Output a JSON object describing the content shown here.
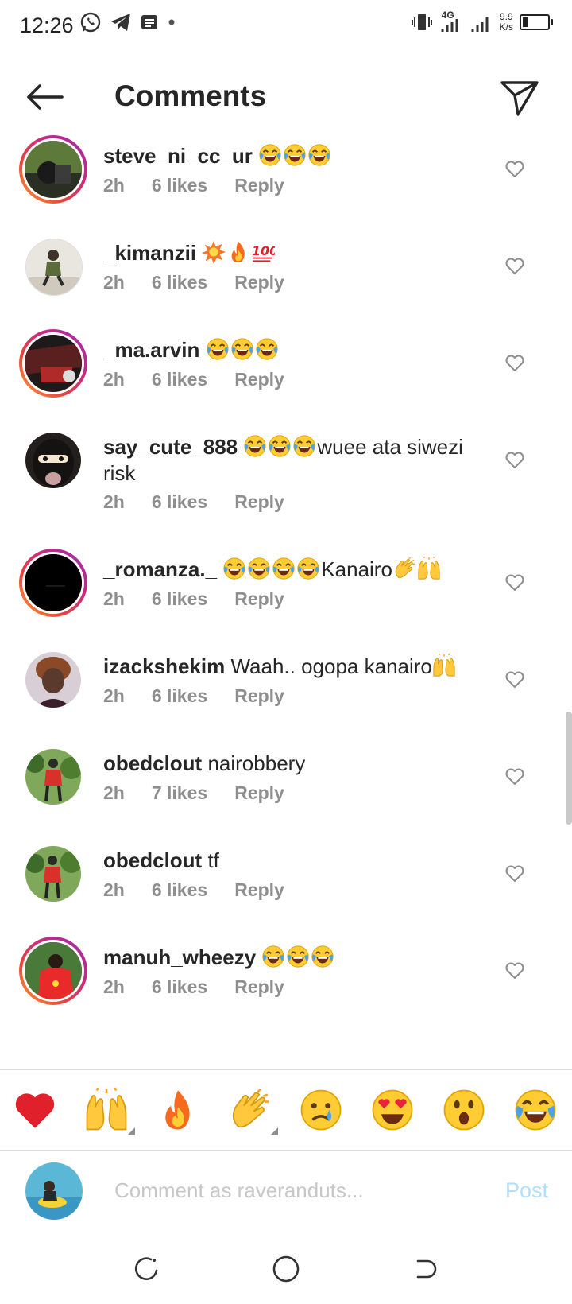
{
  "status_bar": {
    "time": "12:26",
    "network": "4G",
    "speed_top": "9.9",
    "speed_bottom": "K/s"
  },
  "header": {
    "title": "Comments"
  },
  "comments": [
    {
      "username": "steve_ni_cc_ur",
      "text": "",
      "time": "2h",
      "likes": "6 likes",
      "reply": "Reply",
      "ring": true
    },
    {
      "username": "_kimanzii",
      "text": "",
      "time": "2h",
      "likes": "6 likes",
      "reply": "Reply",
      "ring": false
    },
    {
      "username": "_ma.arvin",
      "text": "",
      "time": "2h",
      "likes": "6 likes",
      "reply": "Reply",
      "ring": true
    },
    {
      "username": "say_cute_888",
      "text": "wuee ata siwezi risk",
      "time": "2h",
      "likes": "6 likes",
      "reply": "Reply",
      "ring": false
    },
    {
      "username": "_romanza._",
      "text": "Kanairo",
      "time": "2h",
      "likes": "6 likes",
      "reply": "Reply",
      "ring": true
    },
    {
      "username": "izackshekim",
      "text": "Waah.. ogopa kanairo",
      "time": "2h",
      "likes": "6 likes",
      "reply": "Reply",
      "ring": false
    },
    {
      "username": "obedclout",
      "text": "nairobbery",
      "time": "2h",
      "likes": "7 likes",
      "reply": "Reply",
      "ring": false
    },
    {
      "username": "obedclout",
      "text": "tf",
      "time": "2h",
      "likes": "6 likes",
      "reply": "Reply",
      "ring": false
    },
    {
      "username": "manuh_wheezy",
      "text": "",
      "time": "2h",
      "likes": "6 likes",
      "reply": "Reply",
      "ring": true
    }
  ],
  "emoji_bar": [
    "red-heart",
    "raising-hands",
    "fire",
    "clapping-hands",
    "crying-face",
    "heart-eyes",
    "astonished-face",
    "tears-of-joy"
  ],
  "composer": {
    "placeholder": "Comment as raveranduts...",
    "post_label": "Post"
  },
  "colors": {
    "post_disabled": "#b2dffc",
    "meta_gray": "#8e8e8e",
    "ring_gradient_start": "#f9a338",
    "ring_gradient_end": "#c62a84"
  }
}
